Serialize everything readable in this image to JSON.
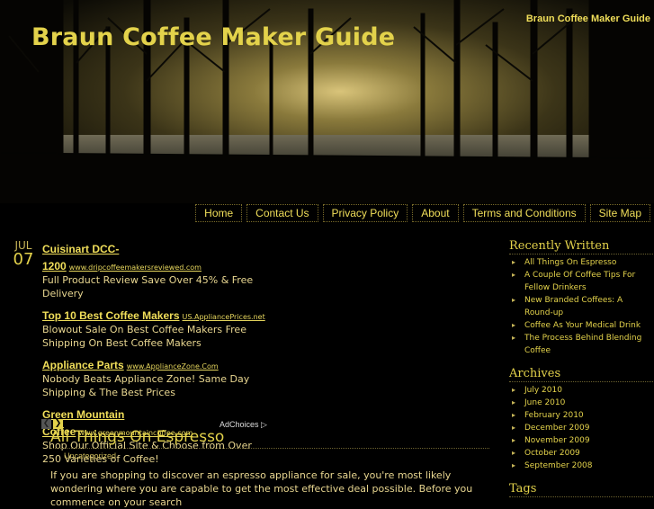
{
  "header": {
    "site_title": "Braun Coffee Maker Guide",
    "top_right_link": "Braun Coffee Maker Guide"
  },
  "nav": [
    "Home",
    "Contact Us",
    "Privacy Policy",
    "About",
    "Terms and Conditions",
    "Site Map"
  ],
  "date": {
    "month": "JUL",
    "day": "07"
  },
  "ads": [
    {
      "title": "Cuisinart DCC-1200",
      "url": "www.dripcoffeemakersreviewed.com",
      "body": "Full Product Review Save Over 45% & Free Delivery"
    },
    {
      "title": "Top 10 Best Coffee Makers",
      "url": "US.AppliancePrices.net",
      "body": "Blowout Sale On Best Coffee Makers Free Shipping On Best Coffee Makers"
    },
    {
      "title": "Appliance Parts",
      "url": "www.ApplianceZone.Com",
      "body": "Nobody Beats Appliance Zone! Same Day Shipping & The Best Prices"
    },
    {
      "title": "Green Mountain Coffee",
      "url": "www.greenmountaincoffee.com",
      "body": "Shop Our Official Site & Choose from Over 250 Varieties of Coffee!"
    }
  ],
  "adchoices": "AdChoices",
  "post": {
    "title": "All Things On Espresso",
    "category": "Uncategorized",
    "body": "If you are shopping to discover an espresso appliance for sale, you're most likely wondering where you are capable to get the most effective deal possible. Before you commence on your search"
  },
  "sidebar": {
    "recent_title": "Recently Written",
    "recent": [
      "All Things On Espresso",
      "A Couple Of Coffee Tips For Fellow Drinkers",
      "New Branded Coffees: A Round-up",
      "Coffee As Your Medical Drink",
      "The Process Behind Blending Coffee"
    ],
    "archives_title": "Archives",
    "archives": [
      "July 2010",
      "June 2010",
      "February 2010",
      "December 2009",
      "November 2009",
      "October 2009",
      "September 2008"
    ],
    "tags_title": "Tags"
  },
  "colors": {
    "accent": "#e3d24b",
    "background": "#000000",
    "text": "#e8d690"
  }
}
